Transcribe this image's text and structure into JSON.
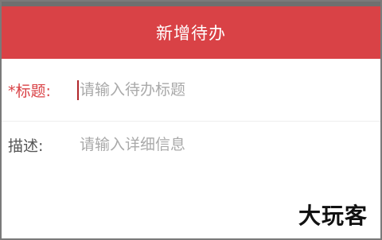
{
  "header": {
    "title": "新增待办"
  },
  "form": {
    "title_label": "*标题:",
    "title_placeholder": "请输入待办标题",
    "desc_label": "描述:",
    "desc_placeholder": "请输入详细信息"
  },
  "watermark": {
    "text": "大玩客"
  },
  "colors": {
    "header_bg": "#d94246",
    "required_label": "#d94246",
    "placeholder": "#a9a9a9"
  }
}
